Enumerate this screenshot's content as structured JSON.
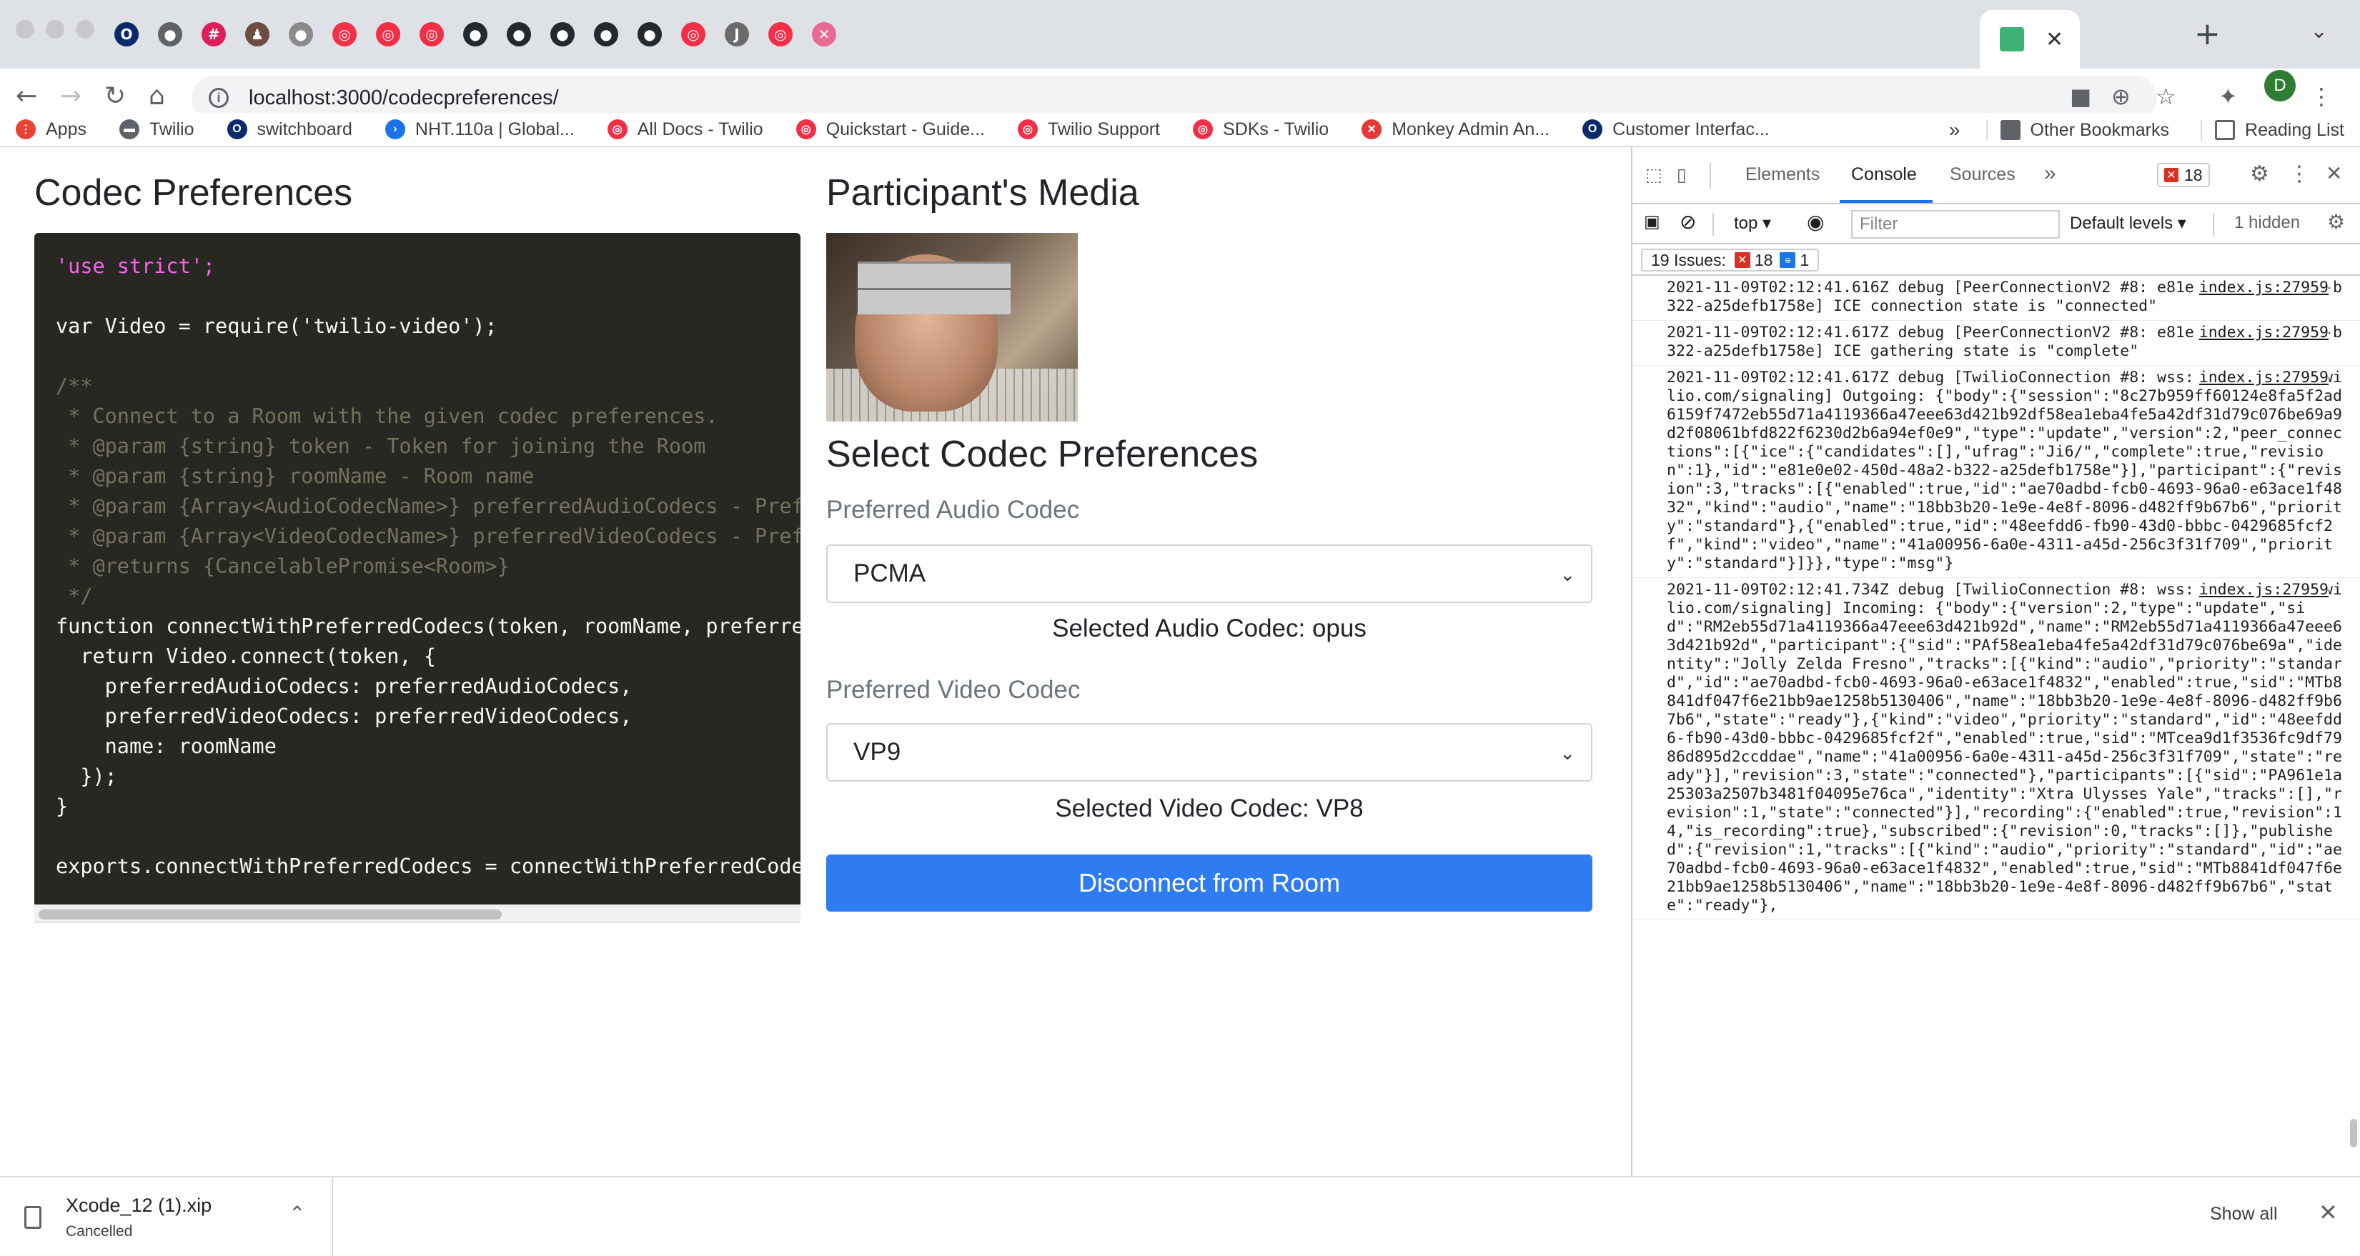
{
  "browser": {
    "url": "localhost:3000/codecpreferences/",
    "active_tab_close": "✕",
    "new_tab": "+",
    "profile_initial": "D",
    "tab_icons": [
      {
        "name": "opera-icon",
        "color": "#0a2a6b",
        "glyph": "O"
      },
      {
        "name": "globe-icon",
        "color": "#5f6368",
        "glyph": "●"
      },
      {
        "name": "slack-icon",
        "color": "#e01e5a",
        "glyph": "#"
      },
      {
        "name": "person-icon",
        "color": "#6d4c41",
        "glyph": "♟"
      },
      {
        "name": "apple-icon",
        "color": "#8a8a8a",
        "glyph": "●"
      },
      {
        "name": "twilio-icon",
        "color": "#f22f46",
        "glyph": "◎"
      },
      {
        "name": "twilio-icon",
        "color": "#f22f46",
        "glyph": "◎"
      },
      {
        "name": "twilio-icon",
        "color": "#f22f46",
        "glyph": "◎"
      },
      {
        "name": "github-icon",
        "color": "#24292e",
        "glyph": "●"
      },
      {
        "name": "github-icon",
        "color": "#24292e",
        "glyph": "●"
      },
      {
        "name": "github-icon",
        "color": "#24292e",
        "glyph": "●"
      },
      {
        "name": "github-icon",
        "color": "#24292e",
        "glyph": "●"
      },
      {
        "name": "github-icon",
        "color": "#24292e",
        "glyph": "●"
      },
      {
        "name": "twilio-icon",
        "color": "#f22f46",
        "glyph": "◎"
      },
      {
        "name": "jira-icon",
        "color": "#6b6b6b",
        "glyph": "J"
      },
      {
        "name": "twilio-icon",
        "color": "#f22f46",
        "glyph": "◎"
      },
      {
        "name": "bandage-icon",
        "color": "#e86a92",
        "glyph": "✕"
      }
    ],
    "bookmarks": [
      {
        "icon": "apps-grid-icon",
        "color": "#ea4335",
        "glyph": "⋮",
        "label": "Apps"
      },
      {
        "icon": "folder-icon",
        "color": "#5f6368",
        "glyph": "▬",
        "label": "Twilio"
      },
      {
        "icon": "switchboard-icon",
        "color": "#0a2a6b",
        "glyph": "O",
        "label": "switchboard"
      },
      {
        "icon": "arrow-icon",
        "color": "#1a73e8",
        "glyph": "›",
        "label": "NHT.110a | Global..."
      },
      {
        "icon": "twilio-icon",
        "color": "#f22f46",
        "glyph": "◎",
        "label": "All Docs - Twilio"
      },
      {
        "icon": "twilio-icon",
        "color": "#f22f46",
        "glyph": "◎",
        "label": "Quickstart - Guide..."
      },
      {
        "icon": "twilio-icon",
        "color": "#f22f46",
        "glyph": "◎",
        "label": "Twilio Support"
      },
      {
        "icon": "twilio-icon",
        "color": "#f22f46",
        "glyph": "◎",
        "label": "SDKs - Twilio"
      },
      {
        "icon": "monkey-icon",
        "color": "#e53935",
        "glyph": "✕",
        "label": "Monkey Admin An..."
      },
      {
        "icon": "opera-icon",
        "color": "#0a2a6b",
        "glyph": "O",
        "label": "Customer Interfac..."
      }
    ],
    "bookmarks_overflow": "»",
    "other_bookmarks": "Other Bookmarks",
    "reading_list": "Reading List"
  },
  "page": {
    "codec_title": "Codec Preferences",
    "media_title": "Participant's Media",
    "select_title": "Select Codec Preferences",
    "audio_label": "Preferred Audio Codec",
    "audio_value": "PCMA",
    "audio_selected": "Selected Audio Codec: opus",
    "video_label": "Preferred Video Codec",
    "video_value": "VP9",
    "video_selected": "Selected Video Codec: VP8",
    "disconnect_label": "Disconnect from Room",
    "code_lines": [
      "'use strict';",
      "",
      "var Video = require('twilio-video');",
      "",
      "/**",
      " * Connect to a Room with the given codec preferences.",
      " * @param {string} token - Token for joining the Room",
      " * @param {string} roomName - Room name",
      " * @param {Array<AudioCodecName>} preferredAudioCodecs - Preferred",
      " * @param {Array<VideoCodecName>} preferredVideoCodecs - Preferred",
      " * @returns {CancelablePromise<Room>}",
      " */",
      "function connectWithPreferredCodecs(token, roomName, preferredAud",
      "  return Video.connect(token, {",
      "    preferredAudioCodecs: preferredAudioCodecs,",
      "    preferredVideoCodecs: preferredVideoCodecs,",
      "    name: roomName",
      "  });",
      "}",
      "",
      "exports.connectWithPreferredCodecs = connectWithPreferredCodecs;"
    ]
  },
  "devtools": {
    "tabs": [
      "Elements",
      "Console",
      "Sources"
    ],
    "more_tabs": "»",
    "error_count": "18",
    "context": "top",
    "filter_placeholder": "Filter",
    "levels": "Default levels",
    "hidden": "1 hidden",
    "issues_label": "19 Issues:",
    "issues_errors": "18",
    "issues_info": "1",
    "logs": [
      {
        "text": "2021-11-09T02:12:41.616Z debug [PeerConnectionV2 #8: e81e0e02-450d-48a2-b322-a25defb1758e] ICE connection state is \"connected\"",
        "source": "index.js:27959"
      },
      {
        "text": "2021-11-09T02:12:41.617Z debug [PeerConnectionV2 #8: e81e0e02-450d-48a2-b322-a25defb1758e] ICE gathering state is \"complete\"",
        "source": "index.js:27959"
      },
      {
        "text": "2021-11-09T02:12:41.617Z debug [TwilioConnection #8: wss://global.vss.twilio.com/signaling] Outgoing: {\"body\":{\"session\":\"8c27b959ff60124e8fa5f2ad6159f7472eb55d71a4119366a47eee63d421b92df58ea1eba4fe5a42df31d79c076be69a9d2f08061bfd822f6230d2b6a94ef0e9\",\"type\":\"update\",\"version\":2,\"peer_connections\":[{\"ice\":{\"candidates\":[],\"ufrag\":\"Ji6/\",\"complete\":true,\"revision\":1},\"id\":\"e81e0e02-450d-48a2-b322-a25defb1758e\"}],\"participant\":{\"revision\":3,\"tracks\":[{\"enabled\":true,\"id\":\"ae70adbd-fcb0-4693-96a0-e63ace1f4832\",\"kind\":\"audio\",\"name\":\"18bb3b20-1e9e-4e8f-8096-d482ff9b67b6\",\"priority\":\"standard\"},{\"enabled\":true,\"id\":\"48eefdd6-fb90-43d0-bbbc-0429685fcf2f\",\"kind\":\"video\",\"name\":\"41a00956-6a0e-4311-a45d-256c3f31f709\",\"priority\":\"standard\"}]}},\"type\":\"msg\"}",
        "source": "index.js:27959"
      },
      {
        "text": "2021-11-09T02:12:41.734Z debug [TwilioConnection #8: wss://global.vss.twilio.com/signaling] Incoming: {\"body\":{\"version\":2,\"type\":\"update\",\"sid\":\"RM2eb55d71a4119366a47eee63d421b92d\",\"name\":\"RM2eb55d71a4119366a47eee63d421b92d\",\"participant\":{\"sid\":\"PAf58ea1eba4fe5a42df31d79c076be69a\",\"identity\":\"Jolly Zelda Fresno\",\"tracks\":[{\"kind\":\"audio\",\"priority\":\"standard\",\"id\":\"ae70adbd-fcb0-4693-96a0-e63ace1f4832\",\"enabled\":true,\"sid\":\"MTb8841df047f6e21bb9ae1258b5130406\",\"name\":\"18bb3b20-1e9e-4e8f-8096-d482ff9b67b6\",\"state\":\"ready\"},{\"kind\":\"video\",\"priority\":\"standard\",\"id\":\"48eefdd6-fb90-43d0-bbbc-0429685fcf2f\",\"enabled\":true,\"sid\":\"MTcea9d1f3536fc9df7986d895d2ccddae\",\"name\":\"41a00956-6a0e-4311-a45d-256c3f31f709\",\"state\":\"ready\"}],\"revision\":3,\"state\":\"connected\"},\"participants\":[{\"sid\":\"PA961e1a25303a2507b3481f04095e76ca\",\"identity\":\"Xtra Ulysses Yale\",\"tracks\":[],\"revision\":1,\"state\":\"connected\"}],\"recording\":{\"enabled\":true,\"revision\":14,\"is_recording\":true},\"subscribed\":{\"revision\":0,\"tracks\":[]},\"published\":{\"revision\":1,\"tracks\":[{\"kind\":\"audio\",\"priority\":\"standard\",\"id\":\"ae70adbd-fcb0-4693-96a0-e63ace1f4832\",\"enabled\":true,\"sid\":\"MTb8841df047f6e21bb9ae1258b5130406\",\"name\":\"18bb3b20-1e9e-4e8f-8096-d482ff9b67b6\",\"state\":\"ready\"},",
        "source": "index.js:27959"
      }
    ]
  },
  "downloads": {
    "file_name": "Xcode_12 (1).xip",
    "status": "Cancelled",
    "show_all": "Show all"
  },
  "colors": {
    "accent": "#2f7bf2",
    "code_bg": "#272822",
    "twilio_red": "#f22f46"
  }
}
